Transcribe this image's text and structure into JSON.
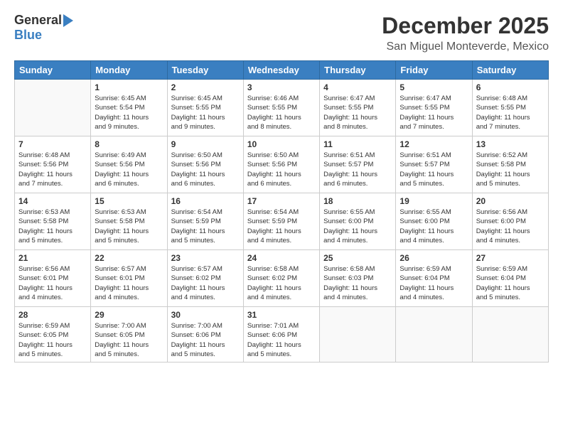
{
  "logo": {
    "general": "General",
    "blue": "Blue"
  },
  "header": {
    "month": "December 2025",
    "location": "San Miguel Monteverde, Mexico"
  },
  "weekdays": [
    "Sunday",
    "Monday",
    "Tuesday",
    "Wednesday",
    "Thursday",
    "Friday",
    "Saturday"
  ],
  "weeks": [
    [
      {
        "day": "",
        "info": ""
      },
      {
        "day": "1",
        "info": "Sunrise: 6:45 AM\nSunset: 5:54 PM\nDaylight: 11 hours\nand 9 minutes."
      },
      {
        "day": "2",
        "info": "Sunrise: 6:45 AM\nSunset: 5:55 PM\nDaylight: 11 hours\nand 9 minutes."
      },
      {
        "day": "3",
        "info": "Sunrise: 6:46 AM\nSunset: 5:55 PM\nDaylight: 11 hours\nand 8 minutes."
      },
      {
        "day": "4",
        "info": "Sunrise: 6:47 AM\nSunset: 5:55 PM\nDaylight: 11 hours\nand 8 minutes."
      },
      {
        "day": "5",
        "info": "Sunrise: 6:47 AM\nSunset: 5:55 PM\nDaylight: 11 hours\nand 7 minutes."
      },
      {
        "day": "6",
        "info": "Sunrise: 6:48 AM\nSunset: 5:55 PM\nDaylight: 11 hours\nand 7 minutes."
      }
    ],
    [
      {
        "day": "7",
        "info": "Sunrise: 6:48 AM\nSunset: 5:56 PM\nDaylight: 11 hours\nand 7 minutes."
      },
      {
        "day": "8",
        "info": "Sunrise: 6:49 AM\nSunset: 5:56 PM\nDaylight: 11 hours\nand 6 minutes."
      },
      {
        "day": "9",
        "info": "Sunrise: 6:50 AM\nSunset: 5:56 PM\nDaylight: 11 hours\nand 6 minutes."
      },
      {
        "day": "10",
        "info": "Sunrise: 6:50 AM\nSunset: 5:56 PM\nDaylight: 11 hours\nand 6 minutes."
      },
      {
        "day": "11",
        "info": "Sunrise: 6:51 AM\nSunset: 5:57 PM\nDaylight: 11 hours\nand 6 minutes."
      },
      {
        "day": "12",
        "info": "Sunrise: 6:51 AM\nSunset: 5:57 PM\nDaylight: 11 hours\nand 5 minutes."
      },
      {
        "day": "13",
        "info": "Sunrise: 6:52 AM\nSunset: 5:58 PM\nDaylight: 11 hours\nand 5 minutes."
      }
    ],
    [
      {
        "day": "14",
        "info": "Sunrise: 6:53 AM\nSunset: 5:58 PM\nDaylight: 11 hours\nand 5 minutes."
      },
      {
        "day": "15",
        "info": "Sunrise: 6:53 AM\nSunset: 5:58 PM\nDaylight: 11 hours\nand 5 minutes."
      },
      {
        "day": "16",
        "info": "Sunrise: 6:54 AM\nSunset: 5:59 PM\nDaylight: 11 hours\nand 5 minutes."
      },
      {
        "day": "17",
        "info": "Sunrise: 6:54 AM\nSunset: 5:59 PM\nDaylight: 11 hours\nand 4 minutes."
      },
      {
        "day": "18",
        "info": "Sunrise: 6:55 AM\nSunset: 6:00 PM\nDaylight: 11 hours\nand 4 minutes."
      },
      {
        "day": "19",
        "info": "Sunrise: 6:55 AM\nSunset: 6:00 PM\nDaylight: 11 hours\nand 4 minutes."
      },
      {
        "day": "20",
        "info": "Sunrise: 6:56 AM\nSunset: 6:00 PM\nDaylight: 11 hours\nand 4 minutes."
      }
    ],
    [
      {
        "day": "21",
        "info": "Sunrise: 6:56 AM\nSunset: 6:01 PM\nDaylight: 11 hours\nand 4 minutes."
      },
      {
        "day": "22",
        "info": "Sunrise: 6:57 AM\nSunset: 6:01 PM\nDaylight: 11 hours\nand 4 minutes."
      },
      {
        "day": "23",
        "info": "Sunrise: 6:57 AM\nSunset: 6:02 PM\nDaylight: 11 hours\nand 4 minutes."
      },
      {
        "day": "24",
        "info": "Sunrise: 6:58 AM\nSunset: 6:02 PM\nDaylight: 11 hours\nand 4 minutes."
      },
      {
        "day": "25",
        "info": "Sunrise: 6:58 AM\nSunset: 6:03 PM\nDaylight: 11 hours\nand 4 minutes."
      },
      {
        "day": "26",
        "info": "Sunrise: 6:59 AM\nSunset: 6:04 PM\nDaylight: 11 hours\nand 4 minutes."
      },
      {
        "day": "27",
        "info": "Sunrise: 6:59 AM\nSunset: 6:04 PM\nDaylight: 11 hours\nand 5 minutes."
      }
    ],
    [
      {
        "day": "28",
        "info": "Sunrise: 6:59 AM\nSunset: 6:05 PM\nDaylight: 11 hours\nand 5 minutes."
      },
      {
        "day": "29",
        "info": "Sunrise: 7:00 AM\nSunset: 6:05 PM\nDaylight: 11 hours\nand 5 minutes."
      },
      {
        "day": "30",
        "info": "Sunrise: 7:00 AM\nSunset: 6:06 PM\nDaylight: 11 hours\nand 5 minutes."
      },
      {
        "day": "31",
        "info": "Sunrise: 7:01 AM\nSunset: 6:06 PM\nDaylight: 11 hours\nand 5 minutes."
      },
      {
        "day": "",
        "info": ""
      },
      {
        "day": "",
        "info": ""
      },
      {
        "day": "",
        "info": ""
      }
    ]
  ]
}
